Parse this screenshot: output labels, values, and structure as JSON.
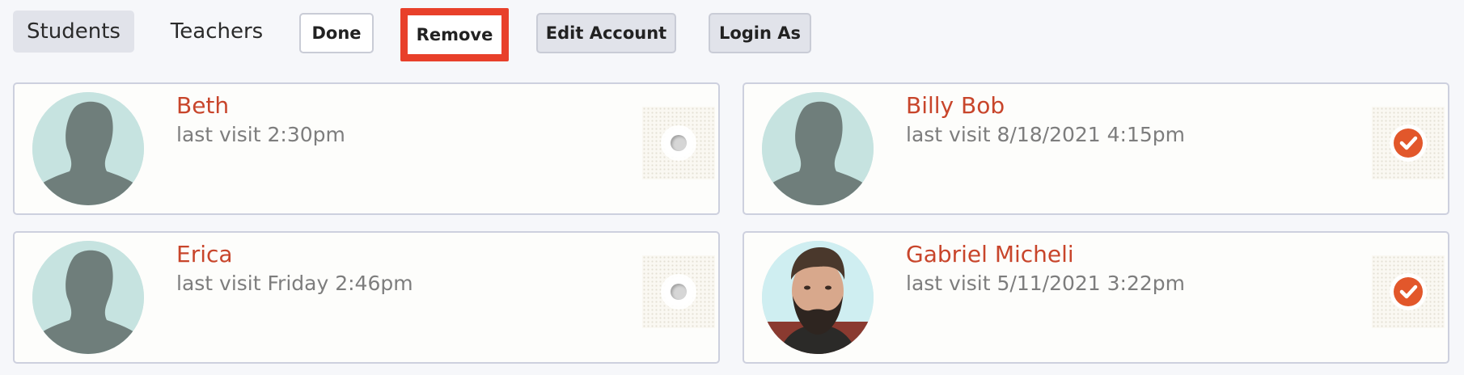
{
  "tabs": [
    {
      "label": "Students",
      "active": true
    },
    {
      "label": "Teachers",
      "active": false
    }
  ],
  "toolbar": {
    "done_label": "Done",
    "remove_label": "Remove",
    "edit_account_label": "Edit Account",
    "login_as_label": "Login As"
  },
  "colors": {
    "accent": "#c8452b",
    "checked": "#e2572b",
    "highlight": "#e8402a"
  },
  "users": [
    {
      "name": "Beth",
      "last_visit": "last visit 2:30pm",
      "selected": false,
      "avatar": "default-avatar-icon"
    },
    {
      "name": "Billy Bob",
      "last_visit": "last visit 8/18/2021 4:15pm",
      "selected": true,
      "avatar": "default-avatar-icon"
    },
    {
      "name": "Erica",
      "last_visit": "last visit Friday 2:46pm",
      "selected": false,
      "avatar": "default-avatar-icon"
    },
    {
      "name": "Gabriel Micheli",
      "last_visit": "last visit 5/11/2021 3:22pm",
      "selected": true,
      "avatar": "user-photo"
    }
  ]
}
